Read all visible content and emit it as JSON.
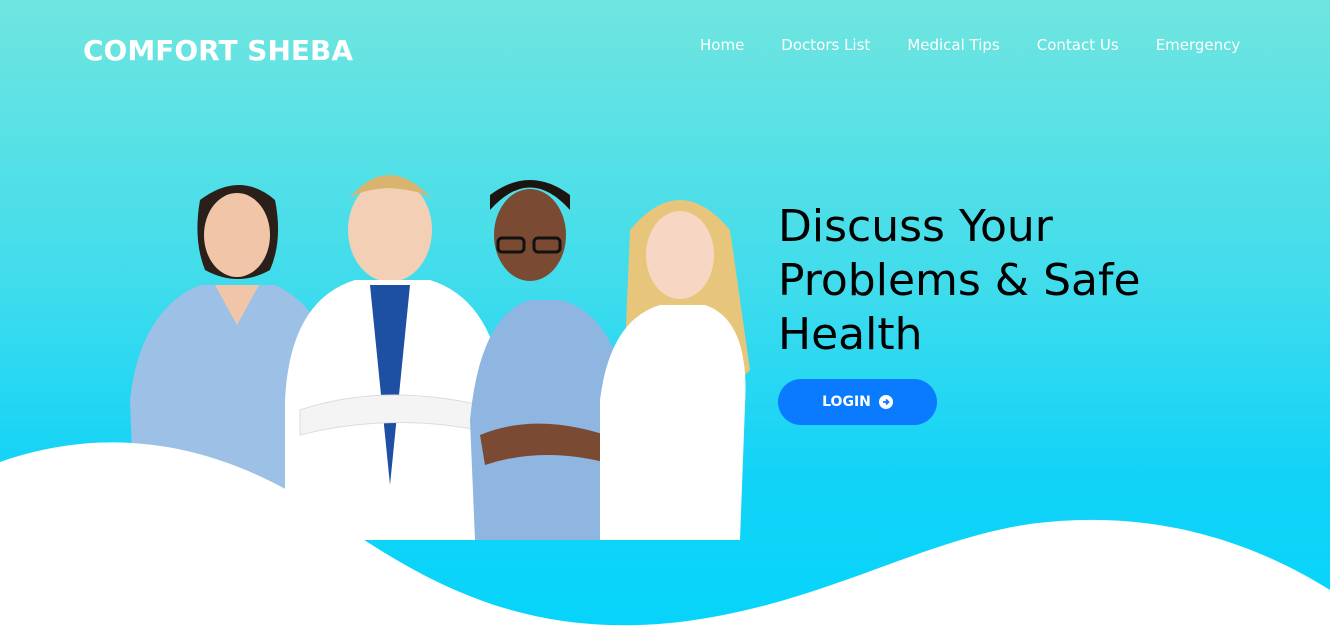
{
  "brand": {
    "name": "COMFORT SHEBA"
  },
  "nav": {
    "items": [
      "Home",
      "Doctors List",
      "Medical Tips",
      "Contact Us",
      "Emergency"
    ]
  },
  "hero": {
    "headline_lines": [
      "Discuss Your",
      "Problems & Safe",
      "Health"
    ],
    "login_label": "LOGIN",
    "login_icon": "arrow-circle-right-icon"
  },
  "colors": {
    "gradient_top": "#6fe5df",
    "gradient_bottom": "#07d4fb",
    "button": "#0a7bff",
    "text_dark": "#000000",
    "text_light": "#ffffff"
  }
}
